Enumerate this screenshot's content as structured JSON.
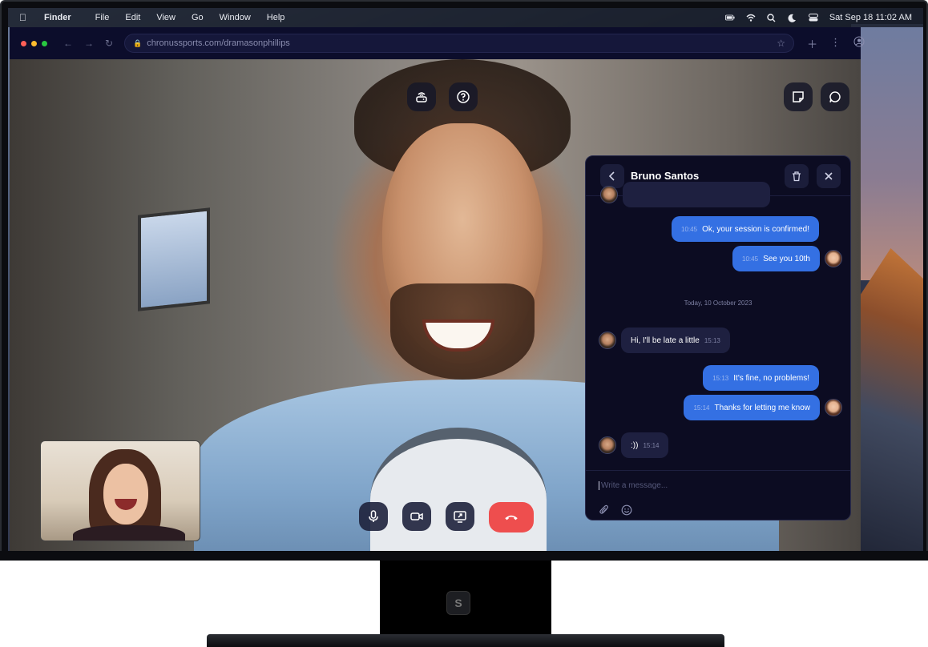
{
  "menubar": {
    "app_name": "Finder",
    "items": [
      "File",
      "Edit",
      "View",
      "Go",
      "Window",
      "Help"
    ],
    "datetime": "Sat Sep 18  11:02 AM"
  },
  "browser": {
    "url": "chronussports.com/dramasonphillips",
    "traffic_light_colors": [
      "#ff5f57",
      "#febc2e",
      "#28c840"
    ]
  },
  "call": {
    "top_controls": [
      "network-icon",
      "help-icon"
    ],
    "top_right_controls": [
      "notes-icon",
      "chat-icon"
    ],
    "bottom_controls": [
      "microphone-icon",
      "camera-icon",
      "screen-share-icon",
      "hang-up-icon"
    ],
    "hangup_color": "#ee4e4e"
  },
  "chat": {
    "title": "Bruno Santos",
    "date_separator": "Today, 10 October 2023",
    "messages": [
      {
        "direction": "out",
        "time": "10:45",
        "text": "Ok, your session is confirmed!"
      },
      {
        "direction": "out",
        "time": "10:45",
        "text": "See you 10th"
      },
      {
        "direction": "in",
        "time": "15:13",
        "text": "Hi, I'll be late a little"
      },
      {
        "direction": "out",
        "time": "15:13",
        "text": "It's fine, no problems!"
      },
      {
        "direction": "out",
        "time": "15:14",
        "text": "Thanks for letting me know"
      },
      {
        "direction": "in",
        "time": "15:14",
        "text": ":))"
      }
    ],
    "input_placeholder": "Write a message...",
    "accent_color": "#3470e3"
  }
}
